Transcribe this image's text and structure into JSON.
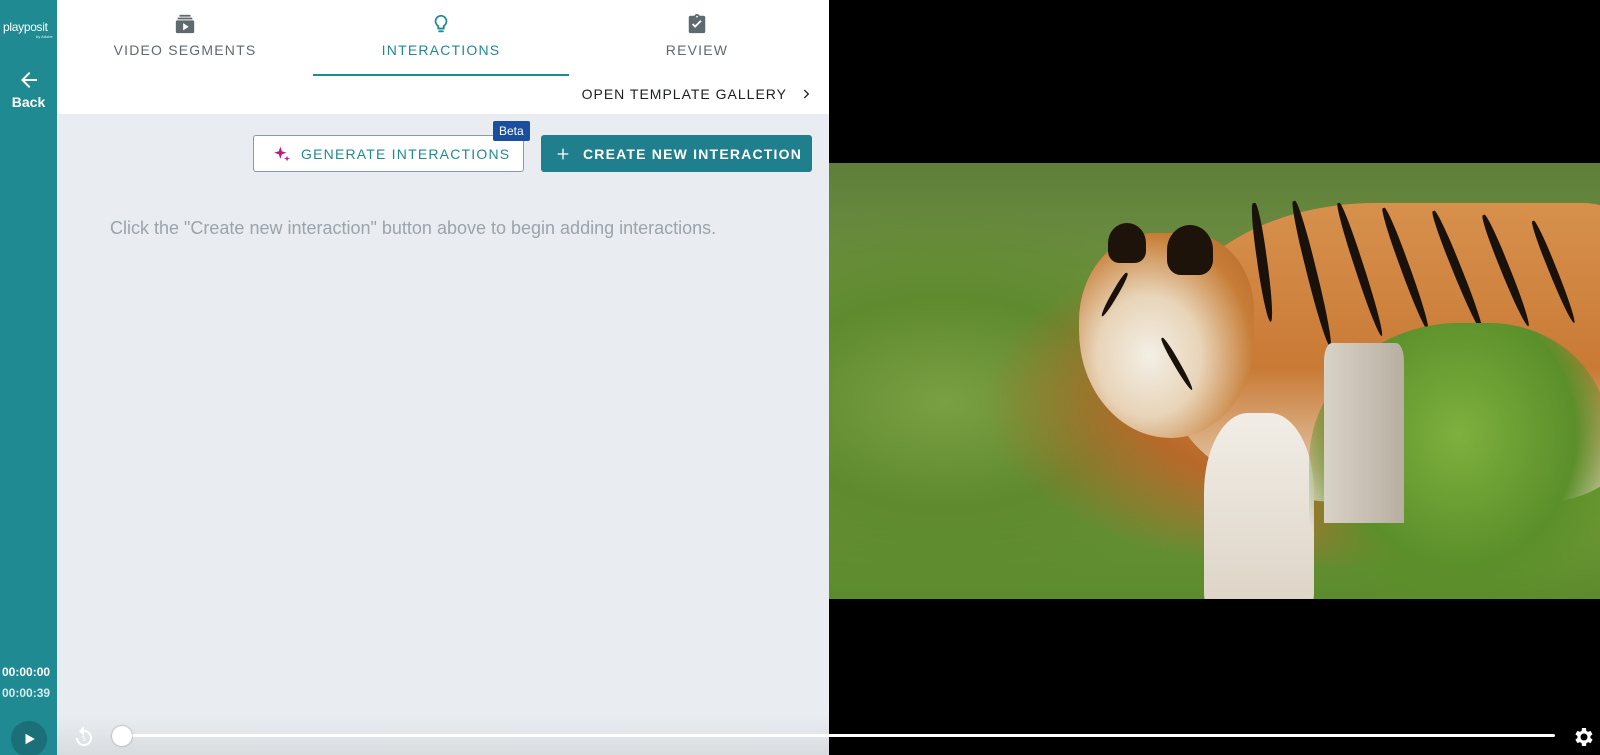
{
  "rail": {
    "logo": "playposit",
    "logo_sub": "by Adobe",
    "back_label": "Back",
    "time_current": "00:00:00",
    "time_total": "00:00:39"
  },
  "tabs": [
    {
      "label": "VIDEO SEGMENTS",
      "icon": "video-stack-icon",
      "active": false
    },
    {
      "label": "INTERACTIONS",
      "icon": "lightbulb-icon",
      "active": true
    },
    {
      "label": "REVIEW",
      "icon": "clipboard-check-icon",
      "active": false
    }
  ],
  "gallery": {
    "label": "OPEN TEMPLATE GALLERY",
    "icon": "chevron-right-icon"
  },
  "actions": {
    "generate_label": "GENERATE INTERACTIONS",
    "beta_badge": "Beta",
    "create_label": "CREATE NEW INTERACTION"
  },
  "empty_message": "Click the \"Create new interaction\" button above to begin adding interactions.",
  "player": {
    "progress": 0,
    "icons": [
      "play-icon",
      "replay-icon",
      "gear-icon"
    ]
  },
  "colors": {
    "brand_teal": "#1f8a92",
    "button_teal": "#1f7f8c",
    "beta_blue": "#1a4fa0",
    "sparkle_magenta": "#c2187a",
    "panel_bg": "#e9edf1"
  }
}
